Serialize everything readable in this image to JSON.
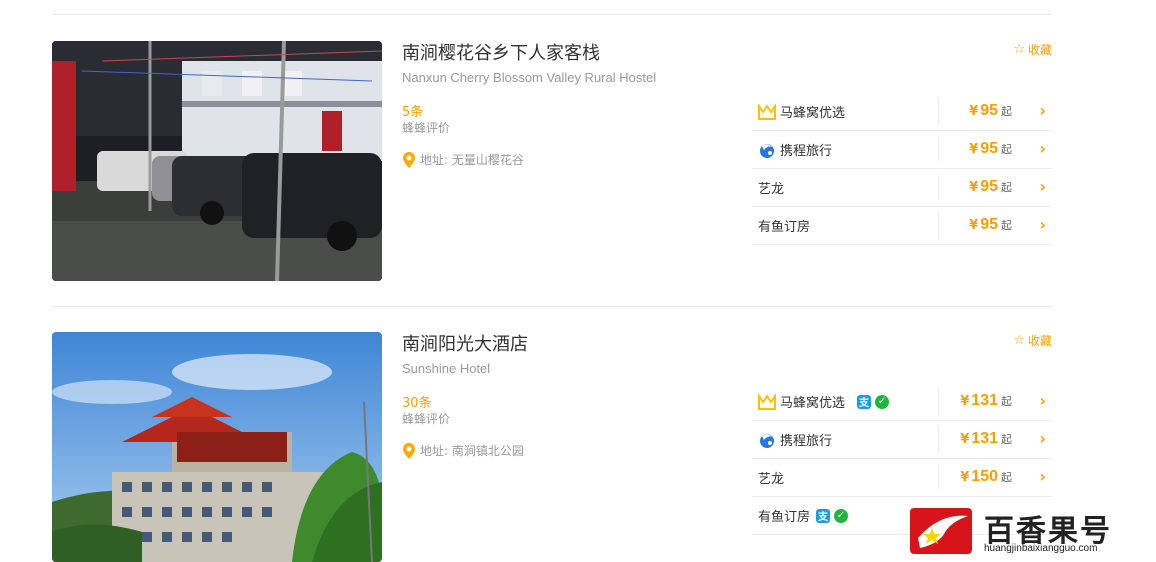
{
  "hotels": [
    {
      "name": "南涧樱花谷乡下人家客栈",
      "english_name": "Nanxun Cherry Blossom Valley Rural Hostel",
      "review_count": "5条",
      "review_label": "蜂蜂评价",
      "address": "地址: 无量山樱花谷",
      "favorite_label": "收藏",
      "offers": [
        {
          "vendor": "马蜂窝优选",
          "icon": "mafengwo-icon",
          "currency": "¥",
          "price": "95",
          "suffix": "起"
        },
        {
          "vendor": "携程旅行",
          "icon": "ctrip-icon",
          "currency": "¥",
          "price": "95",
          "suffix": "起"
        },
        {
          "vendor": "艺龙",
          "icon": "",
          "currency": "¥",
          "price": "95",
          "suffix": "起"
        },
        {
          "vendor": "有鱼订房",
          "icon": "",
          "currency": "¥",
          "price": "95",
          "suffix": "起"
        }
      ]
    },
    {
      "name": "南涧阳光大酒店",
      "english_name": "Sunshine Hotel",
      "review_count": "30条",
      "review_label": "蜂蜂评价",
      "address": "地址: 南涧镇北公园",
      "favorite_label": "收藏",
      "offers": [
        {
          "vendor": "马蜂窝优选",
          "icon": "mafengwo-icon",
          "currency": "¥",
          "price": "131",
          "suffix": "起",
          "payments": [
            "alipay-icon",
            "wechat-pay-icon"
          ]
        },
        {
          "vendor": "携程旅行",
          "icon": "ctrip-icon",
          "currency": "¥",
          "price": "131",
          "suffix": "起"
        },
        {
          "vendor": "艺龙",
          "icon": "",
          "currency": "¥",
          "price": "150",
          "suffix": "起"
        },
        {
          "vendor": "有鱼订房",
          "icon": "",
          "payments": [
            "alipay-icon",
            "wechat-pay-icon"
          ]
        }
      ]
    }
  ],
  "watermark": {
    "title": "百香果号",
    "url": "huangjinbaixiangguo.com"
  },
  "colors": {
    "accent": "#ff9d00",
    "text": "#333333",
    "muted": "#999999"
  }
}
